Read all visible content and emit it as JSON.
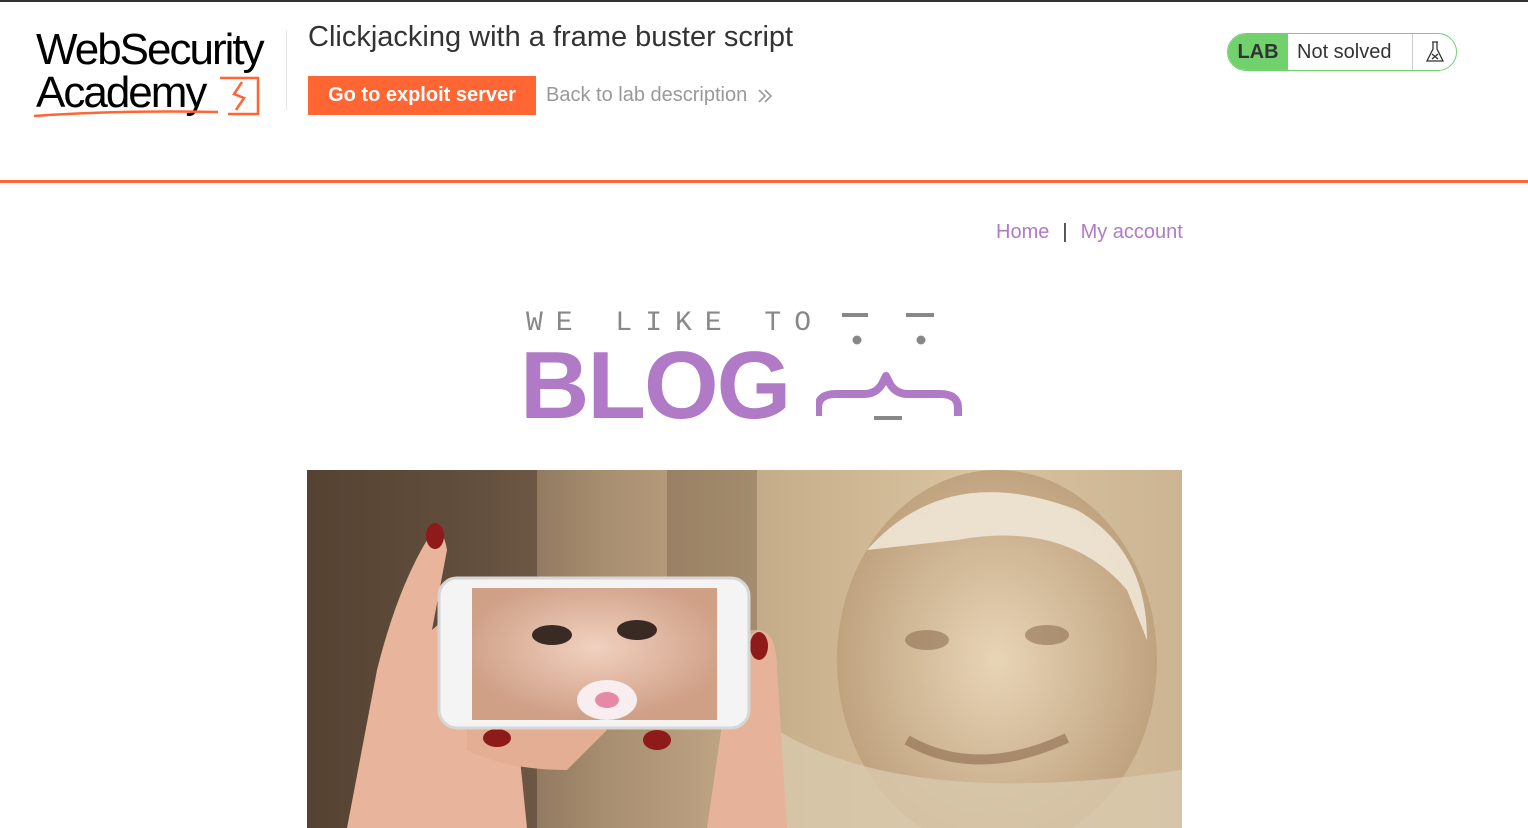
{
  "header": {
    "logo": {
      "line1": "WebSecurity",
      "line2": "Academy"
    },
    "lab_title": "Clickjacking with a frame buster script",
    "exploit_button_label": "Go to exploit server",
    "back_link_label": "Back to lab description",
    "lab_badge": {
      "label": "LAB",
      "status": "Not solved"
    }
  },
  "nav": {
    "home_label": "Home",
    "separator": "|",
    "account_label": "My account"
  },
  "blog_logo": {
    "tagline": "WE LIKE TO",
    "word": "BLOG"
  },
  "colors": {
    "accent_orange": "#ff6633",
    "lab_green": "#70d16d",
    "link_purple": "#b17ac6",
    "muted_gray": "#999999"
  },
  "icons": {
    "back_chevrons": "double-chevron-right-icon",
    "lab_status": "flask-icon"
  }
}
